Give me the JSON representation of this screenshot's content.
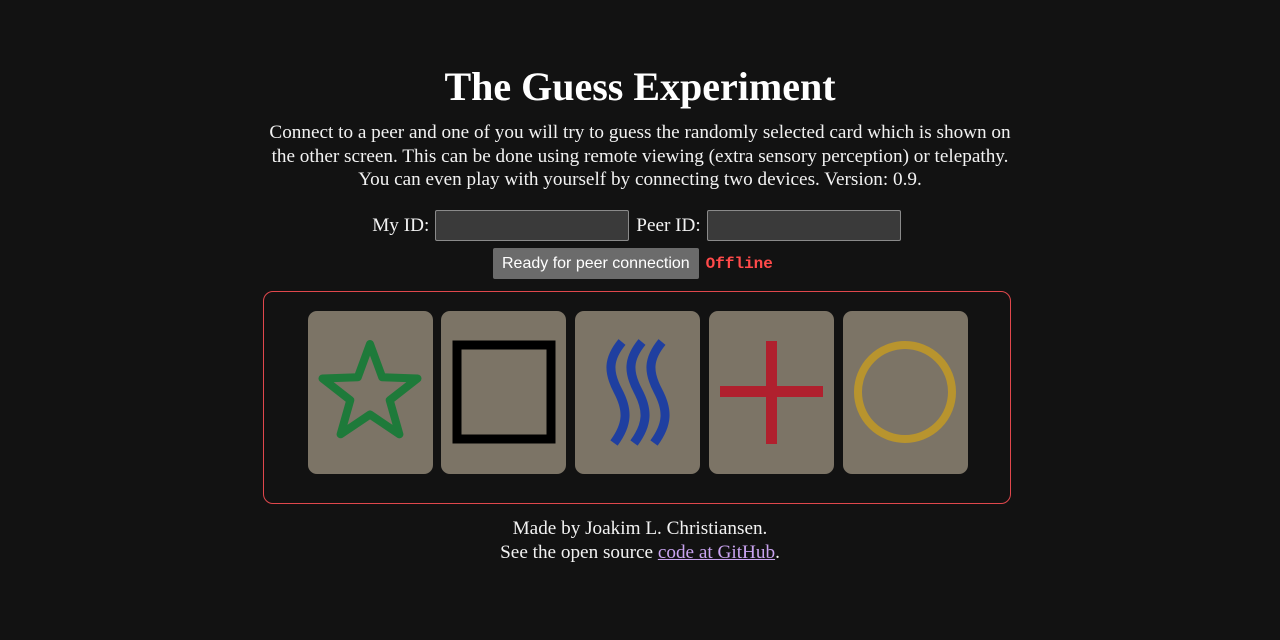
{
  "header": {
    "title": "The Guess Experiment"
  },
  "intro": {
    "text": "Connect to a peer and one of you will try to guess the randomly selected card which is shown on the other screen. This can be done using remote viewing (extra sensory perception) or telepathy. You can even play with yourself by connecting two devices. Version: 0.9."
  },
  "connection": {
    "my_id_label": "My ID:",
    "my_id_value": "",
    "peer_id_label": "Peer ID:",
    "peer_id_value": "",
    "ready_button_label": "Ready for peer connection",
    "status_text": "Offline"
  },
  "cards": [
    {
      "symbol": "star-icon",
      "color": "#1e7a3a"
    },
    {
      "symbol": "square-icon",
      "color": "#000000"
    },
    {
      "symbol": "waves-icon",
      "color": "#1f3fa0"
    },
    {
      "symbol": "cross-icon",
      "color": "#b0202e"
    },
    {
      "symbol": "circle-icon",
      "color": "#b8942e"
    }
  ],
  "footer": {
    "made_by": "Made by Joakim L. Christiansen.",
    "source_prefix": "See the open source ",
    "source_link_text": "code at GitHub",
    "source_suffix": "."
  },
  "colors": {
    "background": "#121212",
    "board_border": "#e0474c",
    "card_background": "#7c7466",
    "status_offline": "#ff4a4a",
    "link": "#c9a3f0"
  }
}
